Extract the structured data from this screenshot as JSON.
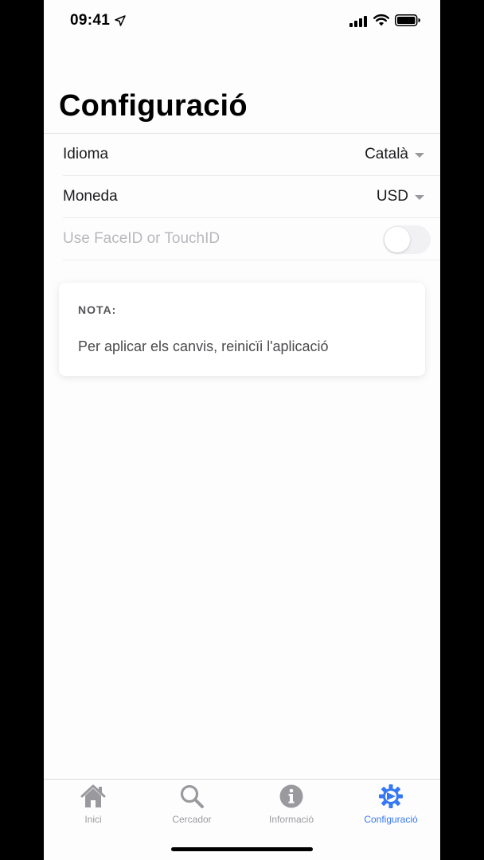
{
  "status_bar": {
    "time": "09:41",
    "icons": [
      "location-arrow-icon",
      "cellular-signal-icon",
      "wifi-icon",
      "battery-icon"
    ]
  },
  "page": {
    "title": "Configuració"
  },
  "settings": [
    {
      "label": "Idioma",
      "value": "Català",
      "control": "dropdown",
      "enabled": true
    },
    {
      "label": "Moneda",
      "value": "USD",
      "control": "dropdown",
      "enabled": true
    },
    {
      "label": "Use FaceID or TouchID",
      "value": "",
      "control": "toggle",
      "enabled": false,
      "on": false
    }
  ],
  "note": {
    "title": "NOTA:",
    "text": "Per aplicar els canvis, reinicïi l'aplicació"
  },
  "tab_bar": {
    "tabs": [
      {
        "label": "Inici",
        "icon": "home-icon",
        "active": false
      },
      {
        "label": "Cercador",
        "icon": "search-icon",
        "active": false
      },
      {
        "label": "Informació",
        "icon": "info-icon",
        "active": false
      },
      {
        "label": "Configuració",
        "icon": "gear-icon",
        "active": true
      }
    ]
  },
  "colors": {
    "accent": "#3478f6",
    "inactive_tab": "#9a9a9e",
    "background": "#fefdfe",
    "disabled_text": "#b8b8bc"
  }
}
